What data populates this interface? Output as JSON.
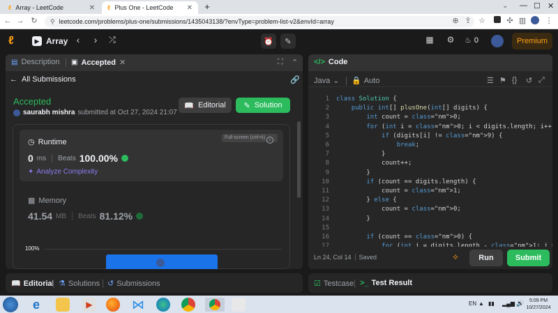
{
  "browser": {
    "tabs": [
      {
        "title": "Array - LeetCode",
        "active": false
      },
      {
        "title": "Plus One - LeetCode",
        "active": true
      }
    ],
    "new_tab": "+",
    "url": "leetcode.com/problems/plus-one/submissions/1435043138/?envType=problem-list-v2&envId=array"
  },
  "header": {
    "problem_list": "Array",
    "streak": "0",
    "premium": "Premium"
  },
  "left_panel": {
    "tabs": {
      "description": "Description",
      "accepted": "Accepted"
    },
    "all_submissions": "All Submissions",
    "status": "Accepted",
    "user": "saurabh mishra",
    "submitted_at": "submitted at Oct 27, 2024 21:07",
    "editorial_btn": "Editorial",
    "solution_btn": "Solution",
    "runtime": {
      "label": "Runtime",
      "value": "0",
      "unit": "ms",
      "beats_label": "Beats",
      "beats_value": "100.00%",
      "analyze": "Analyze Complexity",
      "tooltip": "Full-screen (ctrl+k)"
    },
    "memory": {
      "label": "Memory",
      "value": "41.54",
      "unit": "MB",
      "beats_label": "Beats",
      "beats_value": "81.12%"
    },
    "chart_label": "100%"
  },
  "bottom_left": {
    "editorial": "Editorial",
    "solutions": "Solutions",
    "submissions": "Submissions"
  },
  "code_panel": {
    "title": "Code",
    "language": "Java",
    "mode": "Auto",
    "status": "Ln 24, Col 14",
    "saved": "Saved",
    "run": "Run",
    "submit": "Submit",
    "lines": [
      {
        "n": "1",
        "text": "class Solution {"
      },
      {
        "n": "2",
        "text": "    public int[] plusOne(int[] digits) {"
      },
      {
        "n": "3",
        "text": "        int count = 0;"
      },
      {
        "n": "4",
        "text": "        for (int i = 0; i < digits.length; i++) {"
      },
      {
        "n": "5",
        "text": "            if (digits[i] != 9) {"
      },
      {
        "n": "6",
        "text": "                break;"
      },
      {
        "n": "7",
        "text": "            }"
      },
      {
        "n": "8",
        "text": "            count++;"
      },
      {
        "n": "9",
        "text": "        }"
      },
      {
        "n": "10",
        "text": "        if (count == digits.length) {"
      },
      {
        "n": "11",
        "text": "            count = 1;"
      },
      {
        "n": "12",
        "text": "        } else {"
      },
      {
        "n": "13",
        "text": "            count = 0;"
      },
      {
        "n": "14",
        "text": "        }"
      },
      {
        "n": "15",
        "text": ""
      },
      {
        "n": "16",
        "text": "        if (count == 0) {"
      },
      {
        "n": "17",
        "text": "            for (int i = digits.length - 1; i >= 0;"
      }
    ]
  },
  "bottom_right": {
    "testcase": "Testcase",
    "test_result": "Test Result"
  },
  "taskbar": {
    "lang": "EN",
    "time": "5:09 PM",
    "date": "10/27/2024"
  },
  "colors": {
    "accent_green": "#2cbb5d",
    "accent_orange": "#ffa116",
    "panel": "#262626"
  }
}
